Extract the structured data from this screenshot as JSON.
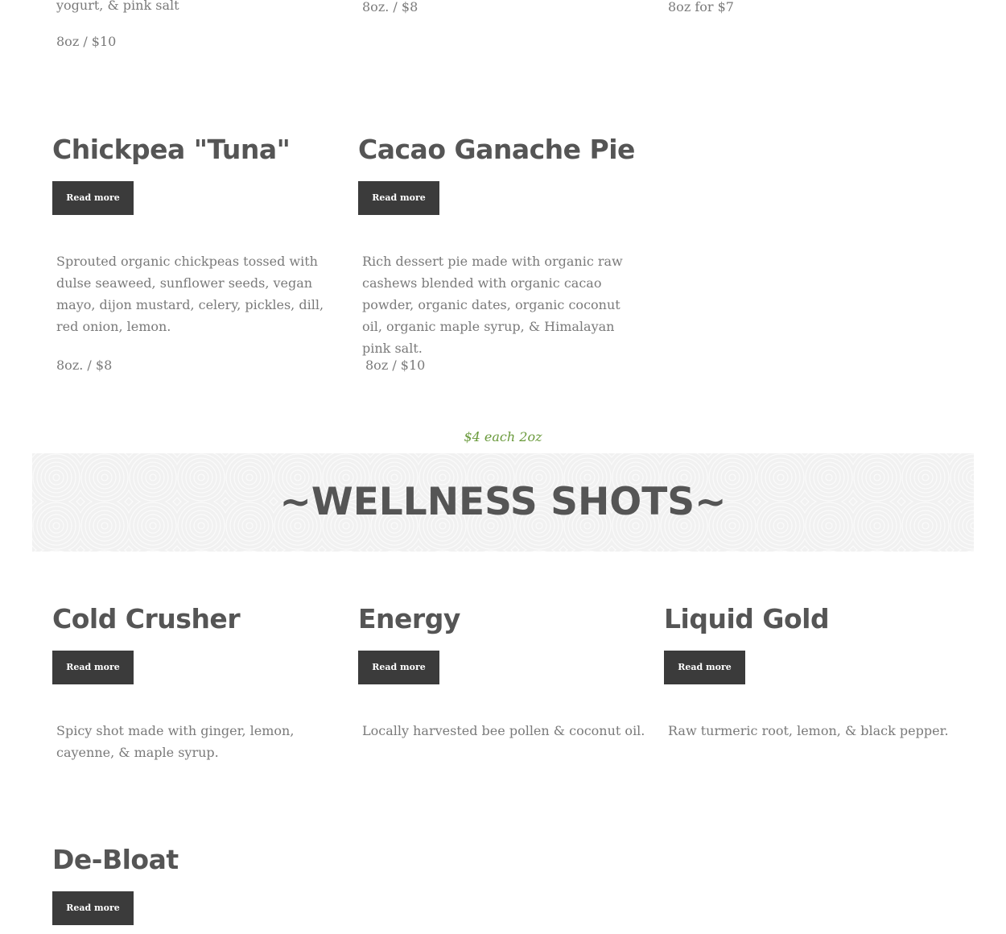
{
  "top_partial": {
    "col1_desc_tail": "yogurt, & pink salt",
    "col1_price": "8oz / $10",
    "col2_price": "8oz. / $8",
    "col3_price": "8oz for $7"
  },
  "menu_items": [
    {
      "title": "Chickpea \"Tuna\"",
      "button": "Read more",
      "description": "Sprouted organic chickpeas tossed with dulse seaweed, sunflower seeds, vegan mayo, dijon mustard, celery, pickles, dill, red onion, lemon.",
      "price": "8oz. / $8"
    },
    {
      "title": "Cacao Ganache Pie",
      "button": "Read more",
      "description": "Rich dessert pie made with organic raw cashews blended with organic cacao powder, organic dates, organic coconut oil, organic maple syrup, & Himalayan pink salt.",
      "price": "8oz / $10"
    }
  ],
  "shots_section": {
    "price_note": "$4 each 2oz",
    "heading": "~WELLNESS SHOTS~",
    "items": [
      {
        "title": "Cold Crusher",
        "button": "Read more",
        "description": "Spicy shot made with ginger, lemon, cayenne, & maple syrup."
      },
      {
        "title": "Energy",
        "button": "Read more",
        "description": "Locally harvested bee pollen & coconut oil."
      },
      {
        "title": "Liquid Gold",
        "button": "Read more",
        "description": "Raw turmeric root, lemon, & black pepper."
      },
      {
        "title": "De-Bloat",
        "button": "Read more"
      }
    ]
  },
  "colors": {
    "button_bg": "#3b3b3b",
    "title_text": "#555555",
    "body_text": "#7a7a7a",
    "accent_green": "#6a9a3c",
    "banner_bg": "#f1f1f1"
  }
}
